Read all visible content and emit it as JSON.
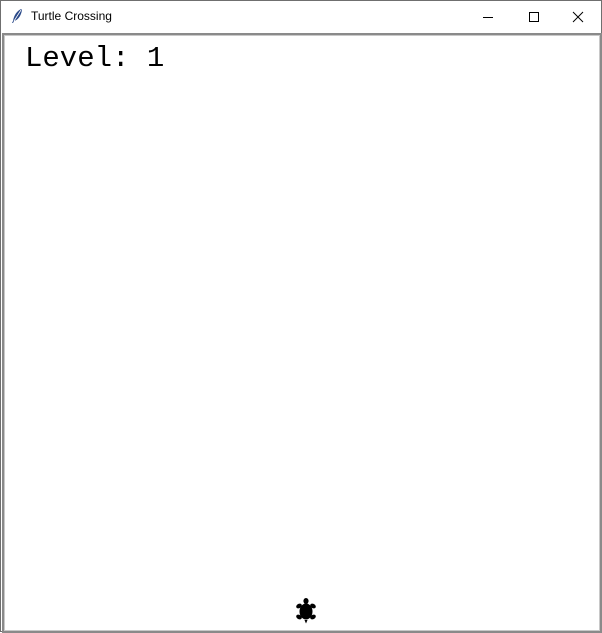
{
  "window": {
    "title": "Turtle Crossing",
    "app_icon": "feather-icon",
    "controls": [
      "minimize-icon",
      "maximize-icon",
      "close-icon"
    ]
  },
  "game": {
    "scoreboard": {
      "label": "Level:",
      "value": "1"
    },
    "player": {
      "shape": "turtle",
      "color": "#000000"
    },
    "background_color": "#ffffff"
  }
}
